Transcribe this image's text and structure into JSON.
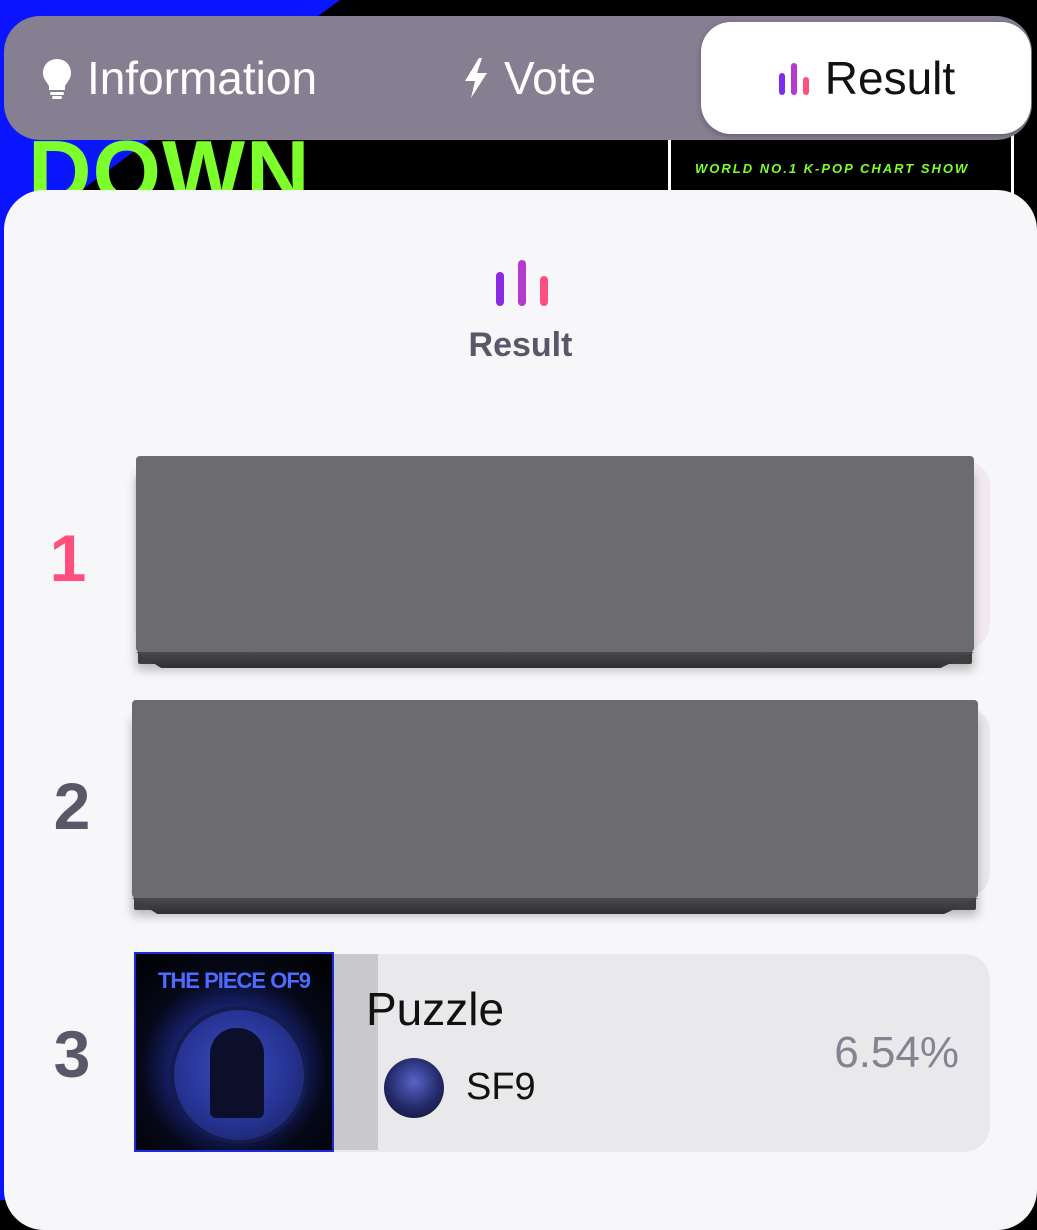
{
  "tabs": {
    "information": {
      "label": "Information",
      "icon": "lightbulb-icon"
    },
    "vote": {
      "label": "Vote",
      "icon": "lightning-icon"
    },
    "result": {
      "label": "Result",
      "icon": "bar-chart-icon",
      "active": true
    }
  },
  "background_poster": {
    "title_fragment": "DOWN",
    "tagline": "WORLD NO.1 K-POP CHART SHOW"
  },
  "result_section": {
    "title": "Result",
    "icon": "bar-chart-icon"
  },
  "ranks": [
    {
      "rank": "1",
      "redacted": true
    },
    {
      "rank": "2",
      "redacted": true
    },
    {
      "rank": "3",
      "song": "Puzzle",
      "artist": "SF9",
      "percent": "6.54%",
      "album_cover_text": "THE PIECE OF9",
      "share": 0.0654
    }
  ],
  "colors": {
    "tab_bar": "#867e91",
    "rank_one": "#ff4f7e",
    "rank_other": "#5b5668",
    "accent_purple": "#8a2be2",
    "accent_pink": "#ff4f7e",
    "poster_green": "#7CFF2A",
    "poster_blue": "#0a14ff"
  }
}
